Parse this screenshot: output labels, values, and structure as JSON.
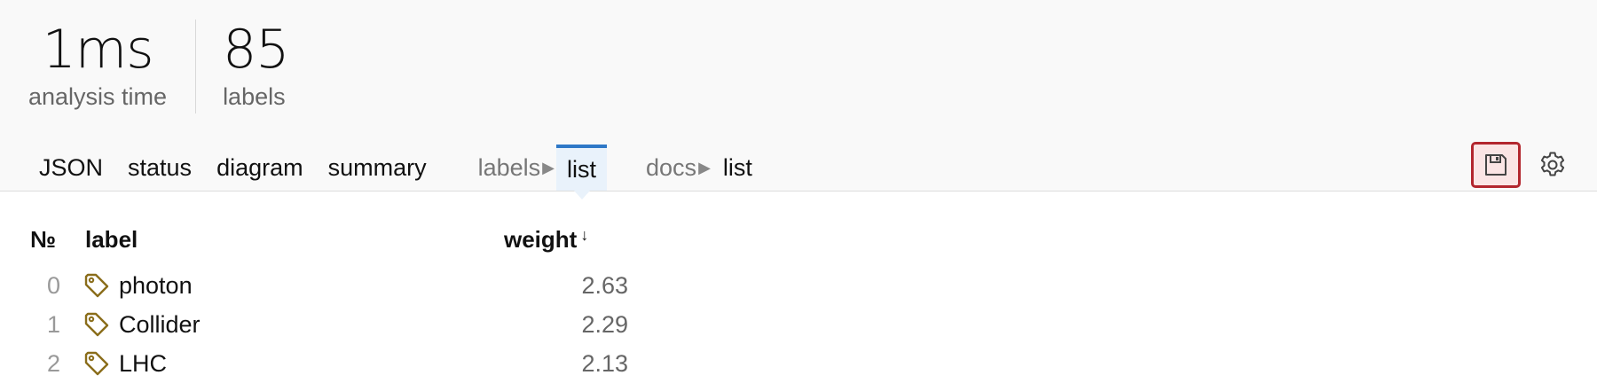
{
  "stats": [
    {
      "value": "1ms",
      "label": "analysis time"
    },
    {
      "value": "85",
      "label": "labels"
    }
  ],
  "tabs": {
    "json": "JSON",
    "status": "status",
    "diagram": "diagram",
    "summary": "summary",
    "labels_prefix": "labels",
    "labels_sub": "list",
    "docs_prefix": "docs",
    "docs_sub": "list"
  },
  "actions": {
    "save_icon": "save-icon",
    "settings_icon": "gear-icon"
  },
  "table": {
    "headers": {
      "no": "№",
      "label": "label",
      "weight": "weight",
      "sort": "↓"
    },
    "rows": [
      {
        "no": "0",
        "label": "photon",
        "weight": "2.63"
      },
      {
        "no": "1",
        "label": "Collider",
        "weight": "2.29"
      },
      {
        "no": "2",
        "label": "LHC",
        "weight": "2.13"
      }
    ]
  },
  "colors": {
    "accent": "#2e78c7",
    "tag": "#8a6d1a",
    "save_border": "#b3262e",
    "save_bg": "#fbe5e5"
  }
}
